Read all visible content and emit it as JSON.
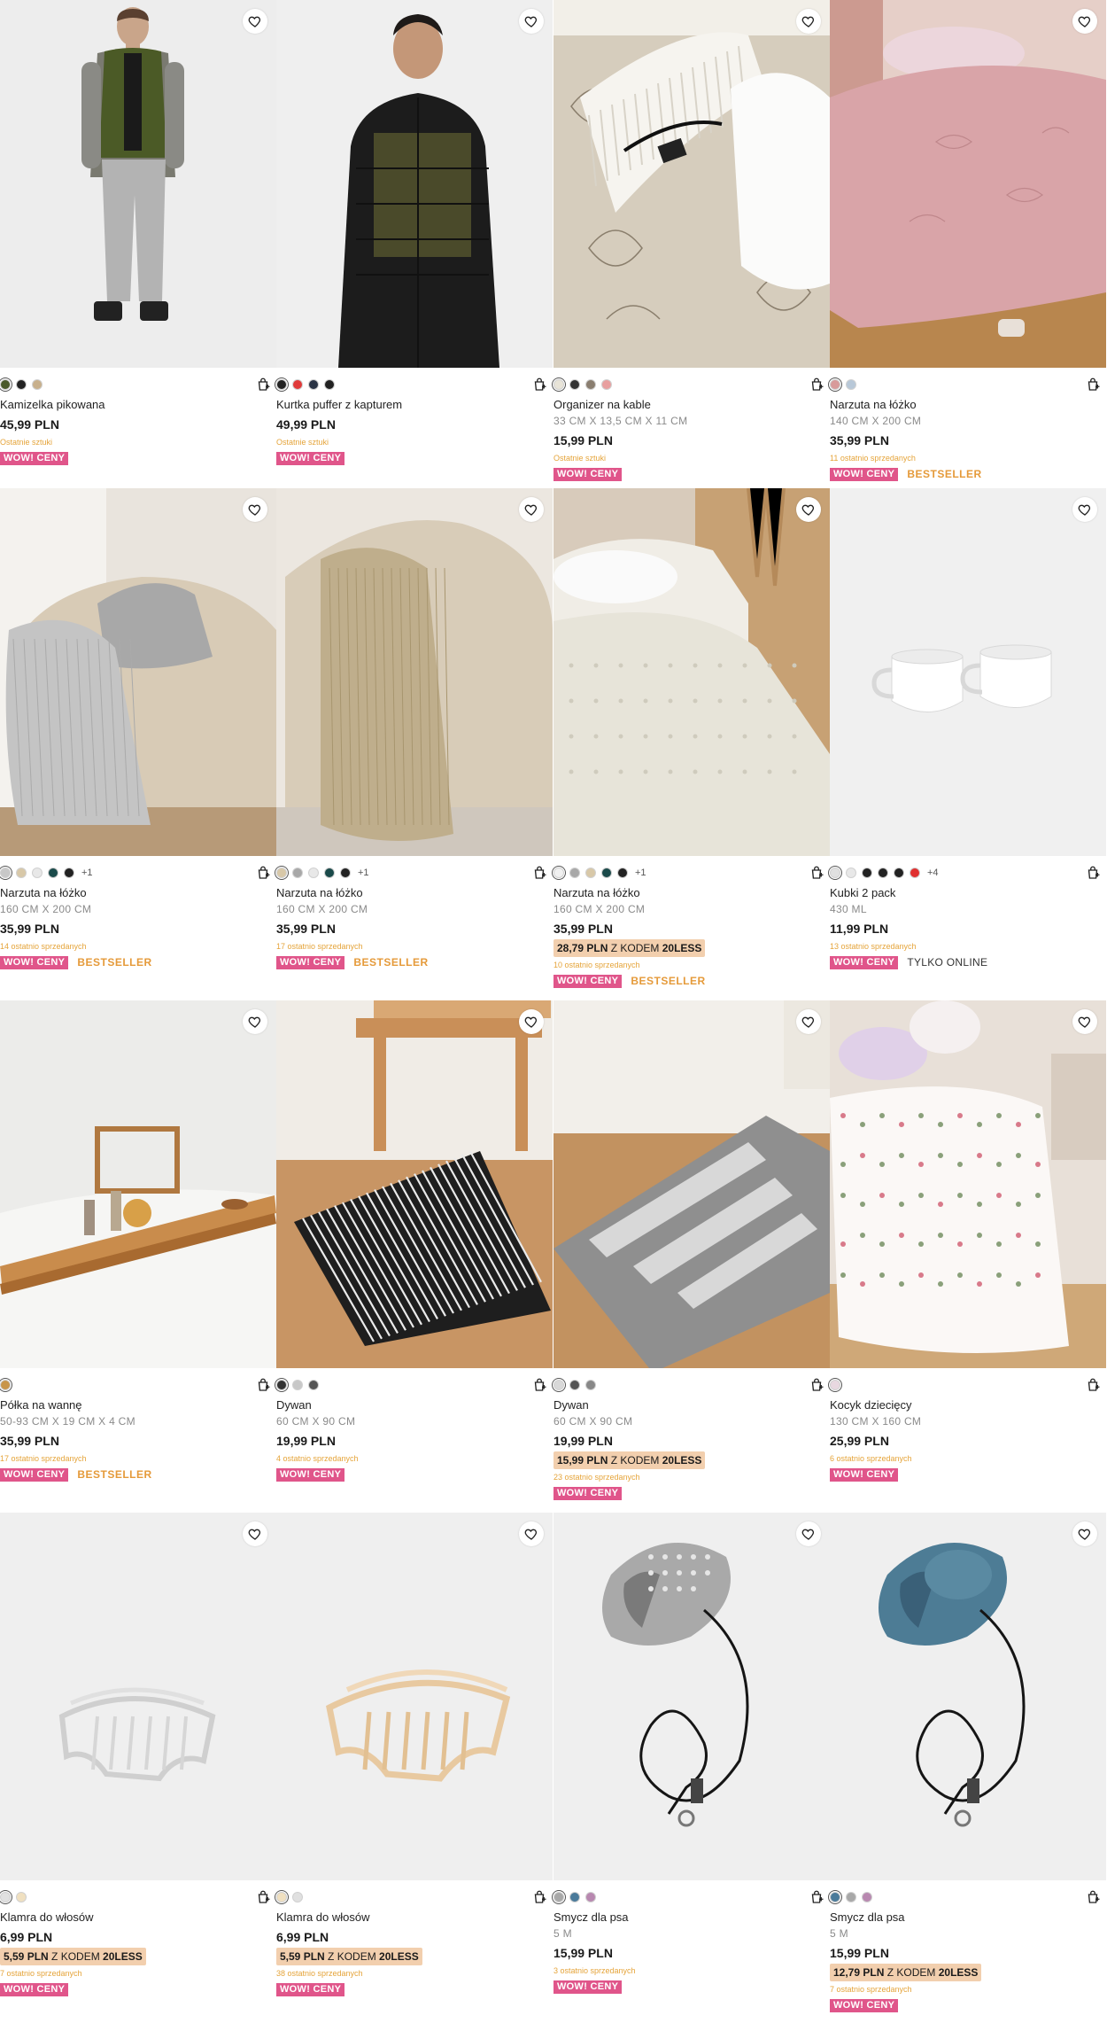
{
  "products": [
    {
      "name": "Kamizelka pikowana",
      "dims": "",
      "price": "45,99 PLN",
      "promo": null,
      "stock": "Ostatnie sztuki",
      "badge": "WOW! CENY",
      "extra": "",
      "swatches": [
        "#4a5a2a",
        "#222222",
        "#c8b08c"
      ],
      "more": "",
      "image": "vest"
    },
    {
      "name": "Kurtka puffer z kapturem",
      "dims": "",
      "price": "49,99 PLN",
      "promo": null,
      "stock": "Ostatnie sztuki",
      "badge": "WOW! CENY",
      "extra": "",
      "swatches": [
        "#222222",
        "#e03a3a",
        "#2a3344",
        "#222222"
      ],
      "more": "",
      "image": "jacket"
    },
    {
      "name": "Organizer na kable",
      "dims": "33 CM X 13,5 CM X 11 CM",
      "price": "15,99 PLN",
      "promo": null,
      "stock": "Ostatnie sztuki",
      "badge": "WOW! CENY",
      "extra": "",
      "swatches": [
        "#e8e4d8",
        "#333333",
        "#8a7e70",
        "#e8a0a0"
      ],
      "more": "",
      "image": "organizer"
    },
    {
      "name": "Narzuta na łóżko",
      "dims": "140 CM X 200 CM",
      "price": "35,99 PLN",
      "promo": null,
      "stock": "11 ostatnio sprzedanych",
      "badge": "WOW! CENY",
      "extra": "BESTSELLER",
      "swatches": [
        "#d89a9a",
        "#b8c8d8"
      ],
      "more": "",
      "image": "pinkbed"
    },
    {
      "name": "Narzuta na łóżko",
      "dims": "160 CM X 200 CM",
      "price": "35,99 PLN",
      "promo": null,
      "stock": "14 ostatnio sprzedanych",
      "badge": "WOW! CENY",
      "extra": "BESTSELLER",
      "swatches": [
        "#c8c8c8",
        "#d8c8a8",
        "#e8e8e8",
        "#1a4a4a",
        "#222222"
      ],
      "more": "+1",
      "image": "throwgrey"
    },
    {
      "name": "Narzuta na łóżko",
      "dims": "160 CM X 200 CM",
      "price": "35,99 PLN",
      "promo": null,
      "stock": "17 ostatnio sprzedanych",
      "badge": "WOW! CENY",
      "extra": "BESTSELLER",
      "swatches": [
        "#d8c8a8",
        "#a8a8a8",
        "#e8e8e8",
        "#1a4a4a",
        "#222222"
      ],
      "more": "+1",
      "image": "throwbeige"
    },
    {
      "name": "Narzuta na łóżko",
      "dims": "160 CM X 200 CM",
      "price": "35,99 PLN",
      "promo": {
        "price": "28,79 PLN",
        "text": " Z KODEM ",
        "code": "20LESS"
      },
      "stock": "10 ostatnio sprzedanych",
      "badge": "WOW! CENY",
      "extra": "BESTSELLER",
      "swatches": [
        "#f0f0f0",
        "#a8a8a8",
        "#d8c8a8",
        "#1a4a4a",
        "#222222"
      ],
      "more": "+1",
      "image": "bedwhite"
    },
    {
      "name": "Kubki 2 pack",
      "dims": "430 ML",
      "price": "11,99 PLN",
      "promo": null,
      "stock": "13 ostatnio sprzedanych",
      "badge": "WOW! CENY",
      "extra": "TYLKO ONLINE",
      "swatches": [
        "#e0e0e0",
        "#e8e8e8",
        "#222222",
        "#222222",
        "#222222",
        "#e03030"
      ],
      "more": "+4",
      "image": "mugs"
    },
    {
      "name": "Półka na wannę",
      "dims": "50-93 CM X 19 CM X 4 CM",
      "price": "35,99 PLN",
      "promo": null,
      "stock": "17 ostatnio sprzedanych",
      "badge": "WOW! CENY",
      "extra": "BESTSELLER",
      "swatches": [
        "#c8954a"
      ],
      "more": "",
      "image": "bathshelf"
    },
    {
      "name": "Dywan",
      "dims": "60 CM X 90 CM",
      "price": "19,99 PLN",
      "promo": null,
      "stock": "4 ostatnio sprzedanych",
      "badge": "WOW! CENY",
      "extra": "",
      "swatches": [
        "#333333",
        "#c8c8c8",
        "#555555"
      ],
      "more": "",
      "image": "rugblack"
    },
    {
      "name": "Dywan",
      "dims": "60 CM X 90 CM",
      "price": "19,99 PLN",
      "promo": {
        "price": "15,99 PLN",
        "text": " Z KODEM ",
        "code": "20LESS"
      },
      "stock": "23 ostatnio sprzedanych",
      "badge": "WOW! CENY",
      "extra": "",
      "swatches": [
        "#d8d8d8",
        "#555555",
        "#888888"
      ],
      "more": "",
      "image": "ruggrey"
    },
    {
      "name": "Kocyk dziecięcy",
      "dims": "130 CM X 160 CM",
      "price": "25,99 PLN",
      "promo": null,
      "stock": "6 ostatnio sprzedanych",
      "badge": "WOW! CENY",
      "extra": "",
      "swatches": [
        "#e8d8e0"
      ],
      "more": "",
      "image": "kidblanket"
    },
    {
      "name": "Klamra do włosów",
      "dims": "",
      "price": "6,99 PLN",
      "promo": {
        "price": "5,59 PLN",
        "text": " Z KODEM ",
        "code": "20LESS"
      },
      "stock": "7 ostatnio sprzedanych",
      "badge": "WOW! CENY",
      "extra": "",
      "swatches": [
        "#e0e0e0",
        "#f0e0c0"
      ],
      "more": "",
      "image": "clipsilver"
    },
    {
      "name": "Klamra do włosów",
      "dims": "",
      "price": "6,99 PLN",
      "promo": {
        "price": "5,59 PLN",
        "text": " Z KODEM ",
        "code": "20LESS"
      },
      "stock": "38 ostatnio sprzedanych",
      "badge": "WOW! CENY",
      "extra": "",
      "swatches": [
        "#f0e0c0",
        "#e0e0e0"
      ],
      "more": "",
      "image": "clipgold"
    },
    {
      "name": "Smycz dla psa",
      "dims": "5 M",
      "price": "15,99 PLN",
      "promo": null,
      "stock": "3 ostatnio sprzedanych",
      "badge": "WOW! CENY",
      "extra": "",
      "swatches": [
        "#a8a8a8",
        "#4a7a9a",
        "#b888b0"
      ],
      "more": "",
      "image": "leashgrey"
    },
    {
      "name": "Smycz dla psa",
      "dims": "5 M",
      "price": "15,99 PLN",
      "promo": {
        "price": "12,79 PLN",
        "text": " Z KODEM ",
        "code": "20LESS"
      },
      "stock": "7 ostatnio sprzedanych",
      "badge": "WOW! CENY",
      "extra": "",
      "swatches": [
        "#4a7a9a",
        "#a8a8a8",
        "#b888b0"
      ],
      "more": "",
      "image": "leashblue"
    }
  ],
  "icons": {
    "wishlist": "heart-icon",
    "cart": "add-to-cart-icon"
  },
  "colors": {
    "wow_badge": "#e0558a",
    "bestseller": "#e59a3a",
    "stock_text": "#e5a43a",
    "promo_bg": "#f2cfae"
  }
}
